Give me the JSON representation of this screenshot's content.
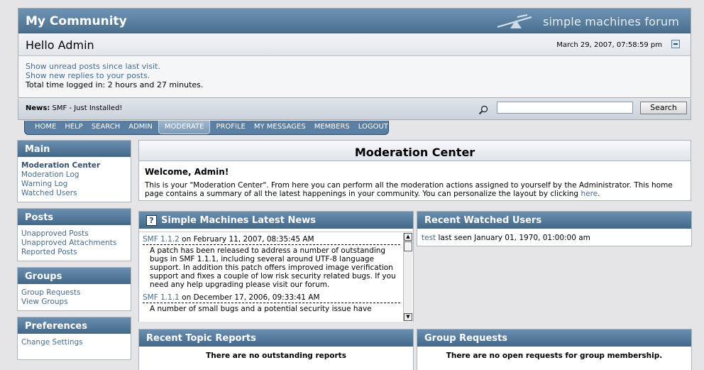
{
  "header": {
    "title": "My Community",
    "logo_text": "simple machines forum",
    "greeting_prefix": "Hello",
    "username": "Admin",
    "datetime": "March 29, 2007, 07:58:59 pm"
  },
  "info": {
    "unread_link": "Show unread posts since last visit.",
    "replies_link": "Show new replies to your posts.",
    "time_logged": "Total time logged in: 2 hours and 27 minutes."
  },
  "news": {
    "label": "News:",
    "text": "SMF - Just Installed!",
    "search_value": "",
    "search_button": "Search"
  },
  "menu": [
    "HOME",
    "HELP",
    "SEARCH",
    "ADMIN",
    "MODERATE",
    "PROFILE",
    "MY MESSAGES",
    "MEMBERS",
    "LOGOUT"
  ],
  "sidebar": {
    "main": {
      "title": "Main",
      "items": [
        "Moderation Center",
        "Moderation Log",
        "Warning Log",
        "Watched Users"
      ]
    },
    "posts": {
      "title": "Posts",
      "items": [
        "Unapproved Posts",
        "Unapproved Attachments",
        "Reported Posts"
      ]
    },
    "groups": {
      "title": "Groups",
      "items": [
        "Group Requests",
        "View Groups"
      ]
    },
    "prefs": {
      "title": "Preferences",
      "items": [
        "Change Settings"
      ]
    }
  },
  "main": {
    "heading": "Moderation Center",
    "welcome_title": "Welcome, Admin!",
    "welcome_body": "This is your \"Moderation Center\". From here you can perform all the moderation actions assigned to yourself by the Administrator. This home page contains a summary of all the latest happenings in your community. You can personalize the layout by clicking",
    "welcome_link": "here",
    "welcome_end": "."
  },
  "latest_news": {
    "title": "Simple Machines Latest News",
    "items": [
      {
        "link": "SMF 1.1.2",
        "date": " on February 11, 2007, 08:35:45 AM",
        "body": "A patch has been released to address a number of outstanding bugs in SMF 1.1.1, including several around UTF-8 language support. In addition this patch offers improved image verification support and fixes a couple of low risk security related bugs. If you need any help upgrading please visit our forum."
      },
      {
        "link": "SMF 1.1.1",
        "date": " on December 17, 2006, 09:33:41 AM",
        "body": "A number of small bugs and a potential security issue have"
      }
    ]
  },
  "watched": {
    "title": "Recent Watched Users",
    "user": "test",
    "text": " last seen January 01, 1970, 01:00:00 am"
  },
  "reports": {
    "title": "Recent Topic Reports",
    "empty": "There are no outstanding reports"
  },
  "group_requests": {
    "title": "Group Requests",
    "empty": "There are no open requests for group membership."
  }
}
